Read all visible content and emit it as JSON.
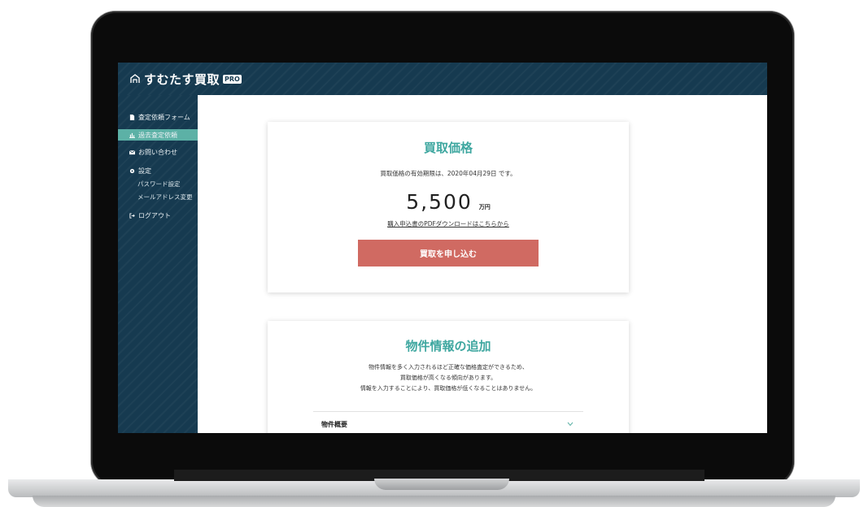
{
  "app": {
    "logo_text": "すむたす買取",
    "logo_badge": "PRO"
  },
  "sidebar": {
    "items": [
      {
        "label": "査定依頼フォーム",
        "icon": "file-icon"
      },
      {
        "label": "過去査定依頼",
        "icon": "bar-chart-icon"
      },
      {
        "label": "お問い合わせ",
        "icon": "envelope-icon"
      },
      {
        "label": "設定",
        "icon": "gear-icon"
      },
      {
        "label": "ログアウト",
        "icon": "logout-icon"
      }
    ],
    "sub_items": [
      "パスワード設定",
      "メールアドレス変更"
    ],
    "active_index": 1
  },
  "purchase_card": {
    "title": "買取価格",
    "validity_note": "買取価格の有効期限は、2020年04月29日 です。",
    "price": "5,500",
    "unit": "万円",
    "pdf_link": "購入申込書のPDFダウンロードはこちらから",
    "apply_button": "買取を申し込む"
  },
  "property_card": {
    "title": "物件情報の追加",
    "description": [
      "物件情報を多く入力されるほど正確な価格査定ができるため、",
      "買取価格が高くなる傾向があります。",
      "情報を入力することにより、買取価格が低くなることはありません。"
    ],
    "accordion_label": "物件概要"
  },
  "colors": {
    "sidebar_bg": "#163a50",
    "accent_teal": "#5cb1a6",
    "button_red": "#d06a62"
  }
}
